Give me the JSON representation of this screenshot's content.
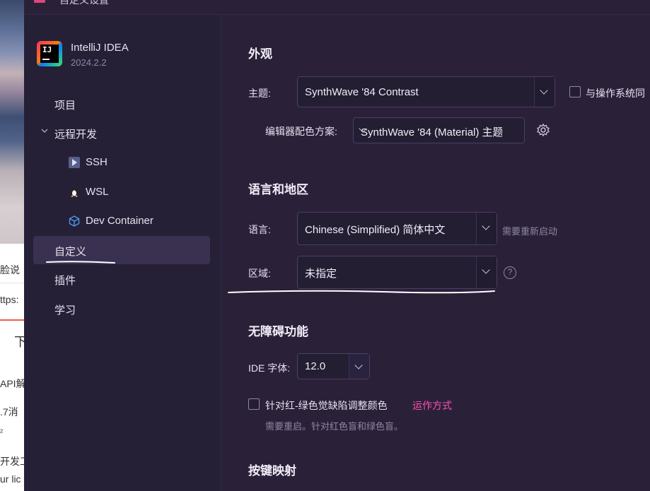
{
  "window": {
    "title": "自定义设置"
  },
  "background_page": {
    "fragments": [
      "脸说",
      "ttps:",
      "下",
      "API解",
      ".7消",
      "²",
      "开发工",
      "ur lic"
    ]
  },
  "sidebar": {
    "app_name": "IntelliJ IDEA",
    "app_version": "2024.2.2",
    "logo_text": "IJ",
    "items": [
      {
        "label": "项目",
        "icon": ""
      },
      {
        "label": "远程开发",
        "icon": "chevron-down-icon"
      },
      {
        "label": "SSH",
        "icon": "ssh-icon"
      },
      {
        "label": "WSL",
        "icon": "linux-penguin-icon"
      },
      {
        "label": "Dev Container",
        "icon": "cube-icon"
      },
      {
        "label": "自定义",
        "icon": "",
        "selected": true
      },
      {
        "label": "插件",
        "icon": ""
      },
      {
        "label": "学习",
        "icon": ""
      }
    ]
  },
  "appearance": {
    "heading": "外观",
    "theme_label": "主题:",
    "theme_value": "SynthWave '84 Contrast",
    "sync_os_label": "与操作系统同",
    "editor_scheme_label": "编辑器配色方案:",
    "editor_scheme_value": "SynthWave '84 (Material) 主题"
  },
  "language": {
    "heading": "语言和地区",
    "language_label": "语言:",
    "language_value": "Chinese (Simplified) 简体中文",
    "restart_hint": "需要重新启动",
    "region_label": "区域:",
    "region_value": "未指定"
  },
  "accessibility": {
    "heading": "无障碍功能",
    "ide_font_label": "IDE 字体:",
    "ide_font_value": "12.0",
    "color_blind_label": "针对红-绿色觉缺陷调整颜色",
    "how_it_works_link": "运作方式",
    "color_blind_hint": "需要重启。针对红色盲和绿色盲。"
  },
  "keymap": {
    "heading": "按键映射"
  },
  "colors": {
    "background": "#2a2139",
    "sidebar": "#262036",
    "selection": "#3a3150",
    "link": "#ff4fb4"
  }
}
